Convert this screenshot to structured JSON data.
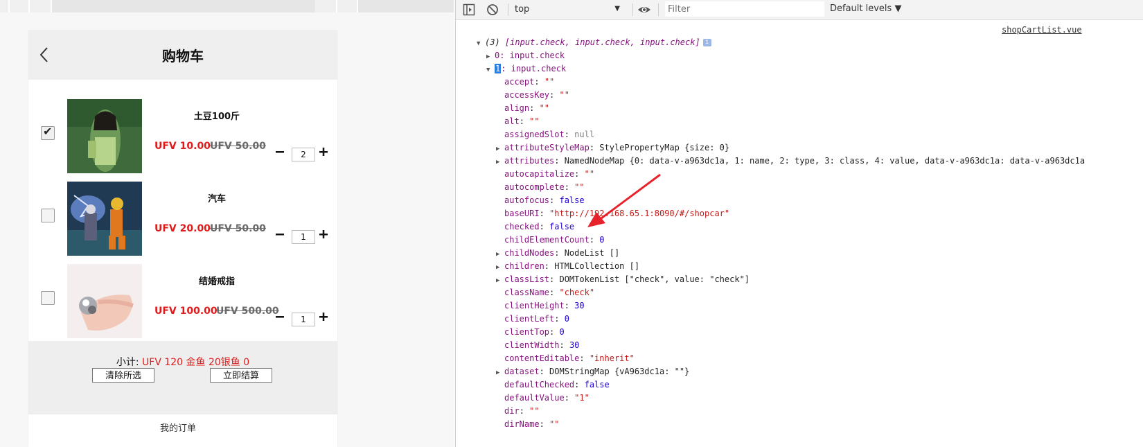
{
  "cart": {
    "title": "购物车",
    "items": [
      {
        "name": "土豆100斤",
        "price": "UFV 10.00",
        "old_price": "UFV 50.00",
        "qty": "2",
        "checked": true
      },
      {
        "name": "汽车",
        "price": "UFV 20.00",
        "old_price": "UFV 50.00",
        "qty": "1",
        "checked": false
      },
      {
        "name": "结婚戒指",
        "price": "UFV 100.00",
        "old_price": "UFV 500.00",
        "qty": "1",
        "checked": false
      }
    ],
    "subtotal_label": "小计:",
    "subtotal_value": "UFV 120 金鱼 20银鱼 0",
    "clear_button": "清除所选",
    "checkout_button": "立即结算",
    "bottom_partial": "我的订单"
  },
  "devtools": {
    "context": "top",
    "filter_placeholder": "Filter",
    "levels": "Default levels ▼",
    "source_link": "shopCartList.vue",
    "array_summary_count": "(3)",
    "array_summary": "[input.check, input.check, input.check]",
    "info_badge": "i",
    "entry0": "0: input.check",
    "entry1_index": "1",
    "entry1_label": ": input.check",
    "props": [
      {
        "k": "accept",
        "v": "\"\"",
        "t": "s",
        "exp": false
      },
      {
        "k": "accessKey",
        "v": "\"\"",
        "t": "s",
        "exp": false
      },
      {
        "k": "align",
        "v": "\"\"",
        "t": "s",
        "exp": false
      },
      {
        "k": "alt",
        "v": "\"\"",
        "t": "s",
        "exp": false
      },
      {
        "k": "assignedSlot",
        "v": "null",
        "t": "g",
        "exp": false
      },
      {
        "k": "attributeStyleMap",
        "v": "StylePropertyMap {size: 0}",
        "t": "o",
        "exp": true
      },
      {
        "k": "attributes",
        "v": "NamedNodeMap {0: data-v-a963dc1a, 1: name, 2: type, 3: class, 4: value, data-v-a963dc1a: data-v-a963dc1a",
        "t": "o",
        "exp": true
      },
      {
        "k": "autocapitalize",
        "v": "\"\"",
        "t": "s",
        "exp": false
      },
      {
        "k": "autocomplete",
        "v": "\"\"",
        "t": "s",
        "exp": false
      },
      {
        "k": "autofocus",
        "v": "false",
        "t": "n",
        "exp": false
      },
      {
        "k": "baseURI",
        "v": "\"http://192.168.65.1:8090/#/shopcar\"",
        "t": "s",
        "exp": false
      },
      {
        "k": "checked",
        "v": "false",
        "t": "n",
        "exp": false
      },
      {
        "k": "childElementCount",
        "v": "0",
        "t": "n",
        "exp": false
      },
      {
        "k": "childNodes",
        "v": "NodeList []",
        "t": "o",
        "exp": true
      },
      {
        "k": "children",
        "v": "HTMLCollection []",
        "t": "o",
        "exp": true
      },
      {
        "k": "classList",
        "v": "DOMTokenList [\"check\", value: \"check\"]",
        "t": "o",
        "exp": true
      },
      {
        "k": "className",
        "v": "\"check\"",
        "t": "s",
        "exp": false
      },
      {
        "k": "clientHeight",
        "v": "30",
        "t": "n",
        "exp": false
      },
      {
        "k": "clientLeft",
        "v": "0",
        "t": "n",
        "exp": false
      },
      {
        "k": "clientTop",
        "v": "0",
        "t": "n",
        "exp": false
      },
      {
        "k": "clientWidth",
        "v": "30",
        "t": "n",
        "exp": false
      },
      {
        "k": "contentEditable",
        "v": "\"inherit\"",
        "t": "s",
        "exp": false
      },
      {
        "k": "dataset",
        "v": "DOMStringMap {vA963dc1a: \"\"}",
        "t": "o",
        "exp": true
      },
      {
        "k": "defaultChecked",
        "v": "false",
        "t": "n",
        "exp": false
      },
      {
        "k": "defaultValue",
        "v": "\"1\"",
        "t": "s",
        "exp": false
      },
      {
        "k": "dir",
        "v": "\"\"",
        "t": "s",
        "exp": false
      },
      {
        "k": "dirName",
        "v": "\"\"",
        "t": "s",
        "exp": false
      }
    ]
  },
  "colors": {
    "price_red": "#e01a1a",
    "annotation_red": "#e8222a",
    "key_purple": "#881280",
    "string_red": "#c41a16",
    "number_blue": "#1c00cf"
  }
}
